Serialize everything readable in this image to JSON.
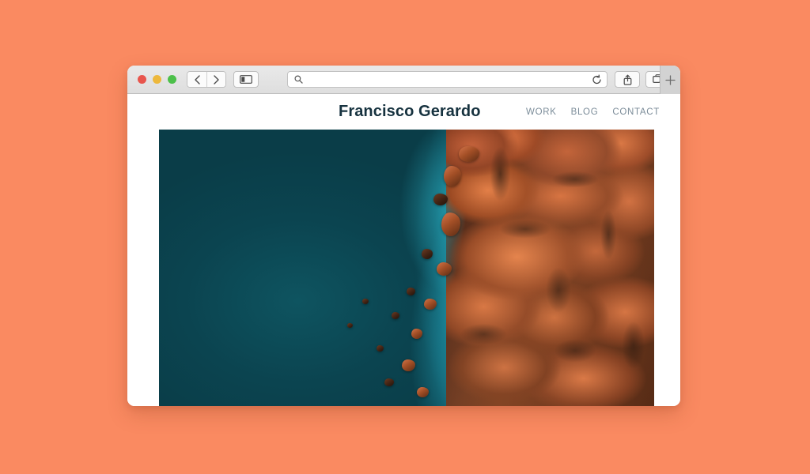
{
  "background": {
    "color": "#fa8a61"
  },
  "browser": {
    "window_controls": [
      {
        "name": "close",
        "color": "#e8554d"
      },
      {
        "name": "minimize",
        "color": "#edb83c"
      },
      {
        "name": "zoom",
        "color": "#4cc04a"
      }
    ],
    "toolbar": {
      "back_label": "‹",
      "forward_label": "›",
      "sidebar_icon": "sidebar-toggle-icon",
      "search": {
        "value": "",
        "placeholder": "",
        "icon": "search-icon"
      },
      "reload_icon": "reload-icon",
      "share_icon": "share-icon",
      "tabs_icon": "show-all-tabs-icon",
      "new_tab_label": "+"
    }
  },
  "site": {
    "title": "Francisco Gerardo",
    "nav": [
      {
        "label": "WORK"
      },
      {
        "label": "BLOG"
      },
      {
        "label": "CONTACT"
      }
    ],
    "title_color": "#16323f",
    "nav_color": "#7b8c99"
  },
  "hero": {
    "alt": "Aerial photo of turquoise ocean waves meeting orange coastal boulders",
    "water_color": "#0c4a55",
    "shallow_color": "#23a7bd",
    "rock_color": "#c4693a",
    "foam_color": "#fff0eb"
  }
}
